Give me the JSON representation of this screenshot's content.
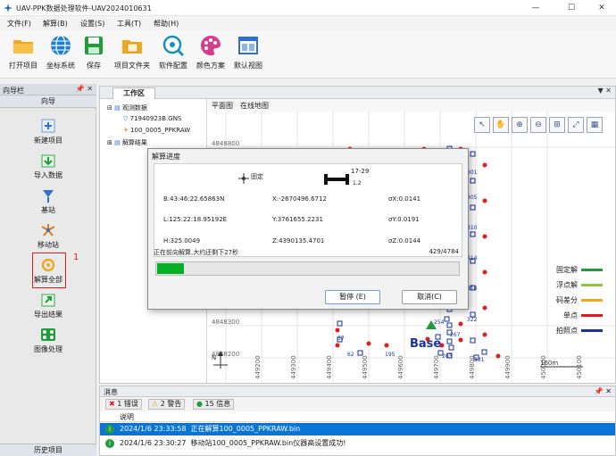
{
  "window": {
    "title": "UAV-PPK数据处理软件-UAV2024010631",
    "minimize": "—",
    "maximize": "☐",
    "close": "✕"
  },
  "menu": [
    "文件(F)",
    "解算(B)",
    "设置(S)",
    "工具(T)",
    "帮助(H)"
  ],
  "toolbar": [
    {
      "label": "打开项目",
      "icon": "folder-icon",
      "color": "#f0a820"
    },
    {
      "label": "坐标系统",
      "icon": "globe-icon",
      "color": "#1f7fd1"
    },
    {
      "label": "保存",
      "icon": "save-icon",
      "color": "#1f9d3a"
    },
    {
      "label": "项目文件夹",
      "icon": "project-folder-icon",
      "color": "#f0a820"
    },
    {
      "label": "软件配置",
      "icon": "config-icon",
      "color": "#1a8fb8"
    },
    {
      "label": "颜色方案",
      "icon": "palette-icon",
      "color": "#c0358f"
    },
    {
      "label": "默认视图",
      "icon": "default-view-icon",
      "color": "#2f6fd0"
    }
  ],
  "navigator": {
    "panel_title": "向导栏",
    "pins": "📌 ✕",
    "subtitle": "向导",
    "items": [
      {
        "label": "新建项目",
        "icon": "new-project-icon"
      },
      {
        "label": "导入数据",
        "icon": "import-data-icon"
      },
      {
        "label": "基站",
        "icon": "base-station-icon"
      },
      {
        "label": "移动站",
        "icon": "rover-icon"
      },
      {
        "label": "解算全部",
        "icon": "solve-all-icon"
      },
      {
        "label": "导出结果",
        "icon": "export-results-icon"
      },
      {
        "label": "图像处理",
        "icon": "image-processing-icon"
      }
    ],
    "annotation": "1",
    "footer": "历史项目"
  },
  "workspace": {
    "tab": "工作区",
    "controls": "▼ ✕",
    "tree": [
      {
        "text": "观测数据",
        "level": 0
      },
      {
        "text": "71940923B.GNS",
        "level": 1
      },
      {
        "text": "100_0005_PPKRAW",
        "level": 1
      },
      {
        "text": "解算结果",
        "level": 0
      }
    ],
    "map_tabs": [
      "平面图",
      "在线地图"
    ],
    "map_tools": [
      "↖",
      "✋",
      "⊕",
      "⊖",
      "⊞",
      "⤢",
      "▦"
    ],
    "y_labels": [
      "4848800",
      "4848300",
      "4848200"
    ],
    "x_labels": [
      "449200",
      "449300",
      "449400",
      "449500",
      "449600",
      "449700",
      "449800",
      "449900",
      "450000",
      "450100"
    ],
    "point_labels": [
      "29",
      "301",
      "305",
      "310",
      "314",
      "318",
      "322",
      "254",
      "267",
      "57",
      "62",
      "195",
      "263",
      "331",
      "33"
    ],
    "base_label": "Base",
    "scale_label": "160m",
    "north_label": "N",
    "legend": [
      {
        "label": "固定解",
        "color": "#1f9d3a"
      },
      {
        "label": "浮点解",
        "color": "#8cc63f"
      },
      {
        "label": "码差分",
        "color": "#f0a820"
      },
      {
        "label": "单点",
        "color": "#e21c1c"
      },
      {
        "label": "拍照点",
        "color": "#1a2fa0"
      }
    ]
  },
  "dialog": {
    "title": "解算进度",
    "status_label": "固定",
    "sat_info": "17-29",
    "sat_sub": "1.2",
    "b": "B:43:46:22.65863N",
    "l": "L:125:22:18.95192E",
    "h": "H:325.0049",
    "x": "X:-2670496.6712",
    "y": "Y:3761655.2231",
    "z": "Z:4390135.4701",
    "sx": "σX:0.0141",
    "sy": "σY:0.0191",
    "sz": "σZ:0.0144",
    "progress_text": "正在前向解算,大约还剩下27秒",
    "progress_count": "429/4784",
    "progress_fraction": 0.0897,
    "pause_button": "暂停 (E)",
    "cancel_button": "取消(C)"
  },
  "messages": {
    "title": "消息",
    "pins": "📌 ✕",
    "filters": [
      {
        "label": "1 错误",
        "icon": "error-icon"
      },
      {
        "label": "2 警告",
        "icon": "warning-icon"
      },
      {
        "label": "15 信息",
        "icon": "info-icon"
      }
    ],
    "column": "说明",
    "rows": [
      {
        "time": "2024/1/6 23:33:58",
        "text": "正在解算100_0005_PPKRAW.bin"
      },
      {
        "time": "2024/1/6 23:30:27",
        "text": "移动站100_0005_PPKRAW.bin仪器高设置成功!"
      }
    ]
  }
}
